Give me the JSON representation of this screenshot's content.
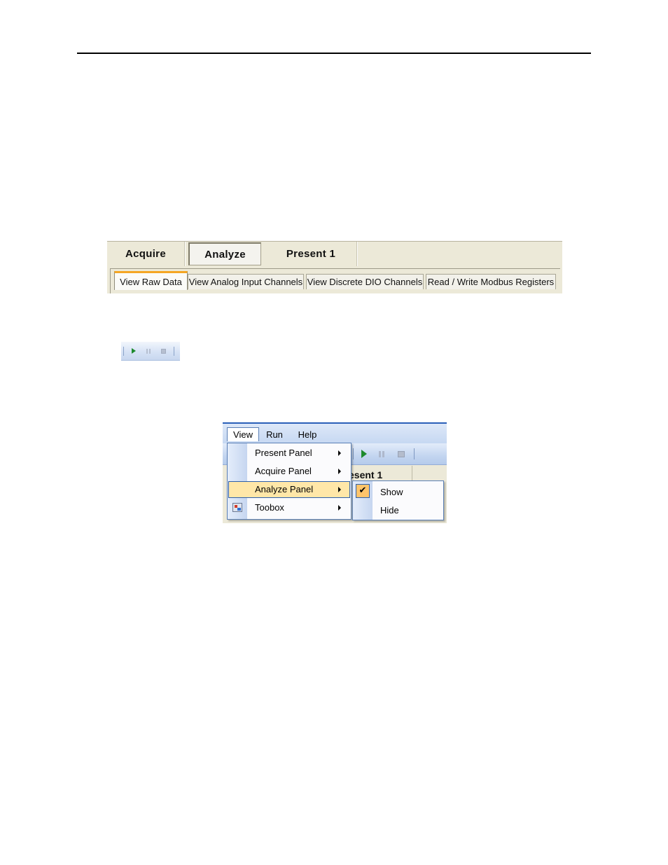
{
  "panel_tabs": {
    "main": [
      "Acquire",
      "Analyze",
      "Present 1"
    ],
    "active_main": "Analyze",
    "sub": [
      "View Raw Data",
      "View Analog Input Channels",
      "View Discrete DIO Channels",
      "Read / Write Modbus Registers"
    ],
    "active_sub": "View Raw Data"
  },
  "toolbar_icons": [
    "play-icon",
    "pause-icon",
    "stop-icon"
  ],
  "menu": {
    "menubar": [
      "View",
      "Run",
      "Help"
    ],
    "open_menu": "View",
    "behind_tab_text": "esent 1",
    "view_items": [
      "Present Panel",
      "Acquire Panel",
      "Analyze Panel",
      "Toobox"
    ],
    "highlighted_item": "Analyze Panel",
    "submenu_items": [
      "Show",
      "Hide"
    ],
    "checked_submenu_item": "Show",
    "check_glyph": "✔"
  },
  "colors": {
    "tab_background": "#ece9d8",
    "active_subtab_accent": "#f5a623",
    "menu_highlight": "#ffe7a8",
    "menu_border": "#2e5fa9",
    "play_green": "#1d8a2d",
    "title_bar_blue": "#2a5fb8"
  }
}
